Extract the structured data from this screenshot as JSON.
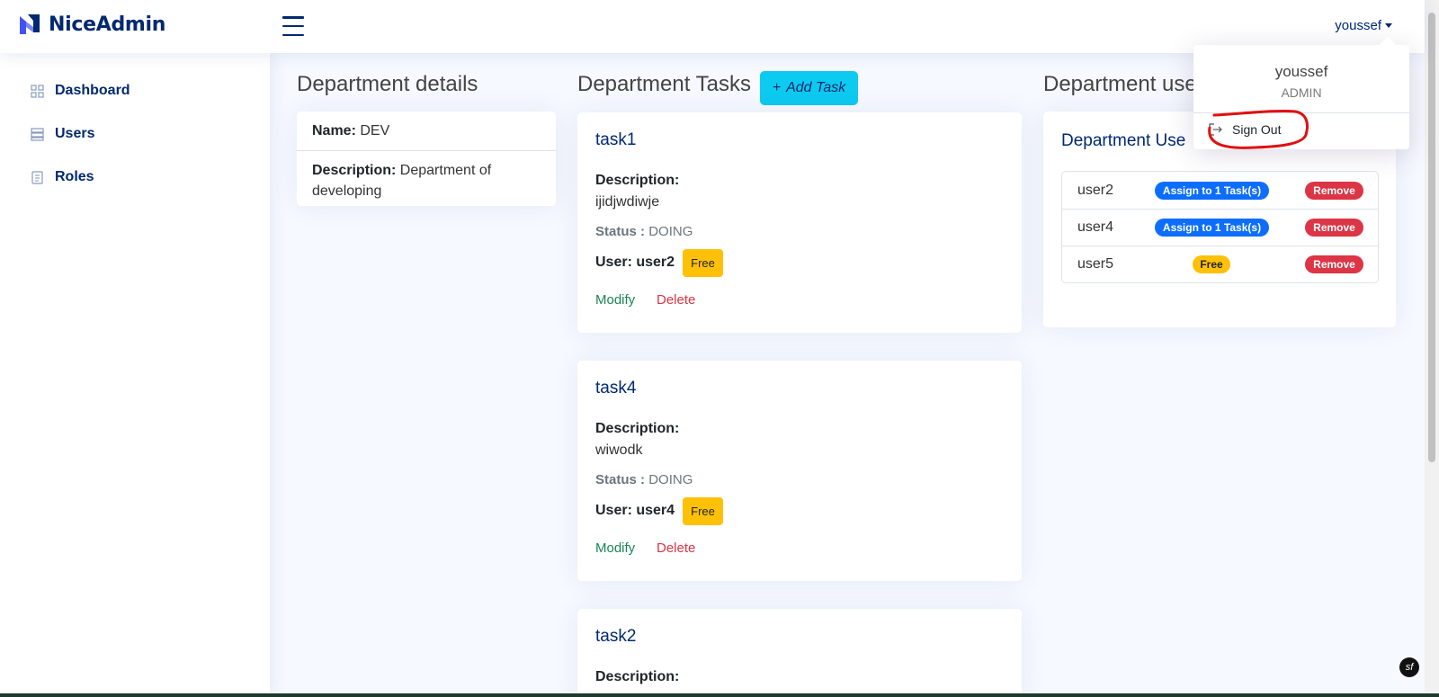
{
  "brand": {
    "name": "NiceAdmin",
    "icon": "logo-icon"
  },
  "header": {
    "user_name": "youssef"
  },
  "sidebar": {
    "items": [
      {
        "label": "Dashboard",
        "icon": "grid-icon"
      },
      {
        "label": "Users",
        "icon": "list-icon"
      },
      {
        "label": "Roles",
        "icon": "document-icon"
      }
    ]
  },
  "department": {
    "title": "Department details",
    "name_label": "Name:",
    "name_value": "DEV",
    "desc_label": "Description:",
    "desc_value": "Department of developing"
  },
  "tasks_section": {
    "title": "Department Tasks",
    "add_label": "Add Task",
    "tasks": [
      {
        "title": "task1",
        "desc_label": "Description:",
        "desc": "ijidjwdiwje",
        "status_label": "Status :",
        "status": "DOING",
        "user_label": "User:",
        "user": "user2",
        "badge": "Free",
        "modify": "Modify",
        "delete": "Delete"
      },
      {
        "title": "task4",
        "desc_label": "Description:",
        "desc": "wiwodk",
        "status_label": "Status :",
        "status": "DOING",
        "user_label": "User:",
        "user": "user4",
        "badge": "Free",
        "modify": "Modify",
        "delete": "Delete"
      },
      {
        "title": "task2",
        "desc_label": "Description:"
      }
    ]
  },
  "users_section": {
    "title": "Department use",
    "card_title": "Department Use",
    "users": [
      {
        "name": "user2",
        "tag": "Assign to 1 Task(s)",
        "tag_color": "#0d6efd",
        "action": "Remove"
      },
      {
        "name": "user4",
        "tag": "Assign to 1 Task(s)",
        "tag_color": "#0d6efd",
        "action": "Remove"
      },
      {
        "name": "user5",
        "tag": "Free",
        "tag_color": "#ffc107",
        "action": "Remove"
      }
    ]
  },
  "dropdown": {
    "name": "youssef",
    "role": "ADMIN",
    "signout_label": "Sign Out"
  },
  "colors": {
    "primary": "#012970",
    "accent": "#0dcaf0",
    "danger": "#dc3545",
    "success": "#198754",
    "warning": "#ffc107"
  }
}
